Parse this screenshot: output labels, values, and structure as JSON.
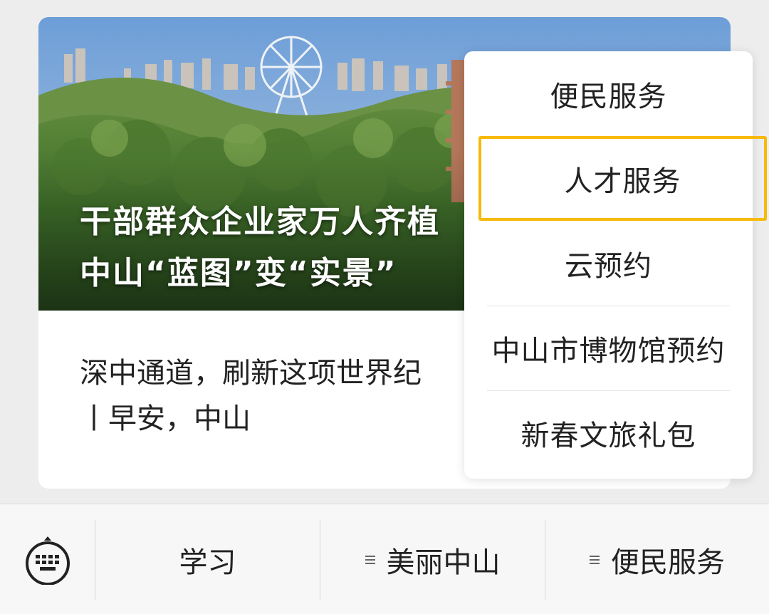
{
  "article": {
    "title_line1": "干部群众企业家万人齐植",
    "title_line2": "中山“蓝图”变“实景”",
    "summary_line1": "深中通道，刷新这项世界纪",
    "summary_line2": "丨早安，中山"
  },
  "popup_menu": {
    "items": [
      {
        "label": "便民服务"
      },
      {
        "label": "人才服务"
      },
      {
        "label": "云预约"
      },
      {
        "label": "中山市博物馆预约"
      },
      {
        "label": "新春文旅礼包"
      }
    ],
    "highlight_color": "#f7b90a"
  },
  "menubar": {
    "keyboard_icon": "keyboard-icon",
    "tabs": [
      {
        "label": "学习"
      },
      {
        "label": "美丽中山",
        "icon": "list-icon"
      },
      {
        "label": "便民服务",
        "icon": "list-icon"
      }
    ]
  }
}
